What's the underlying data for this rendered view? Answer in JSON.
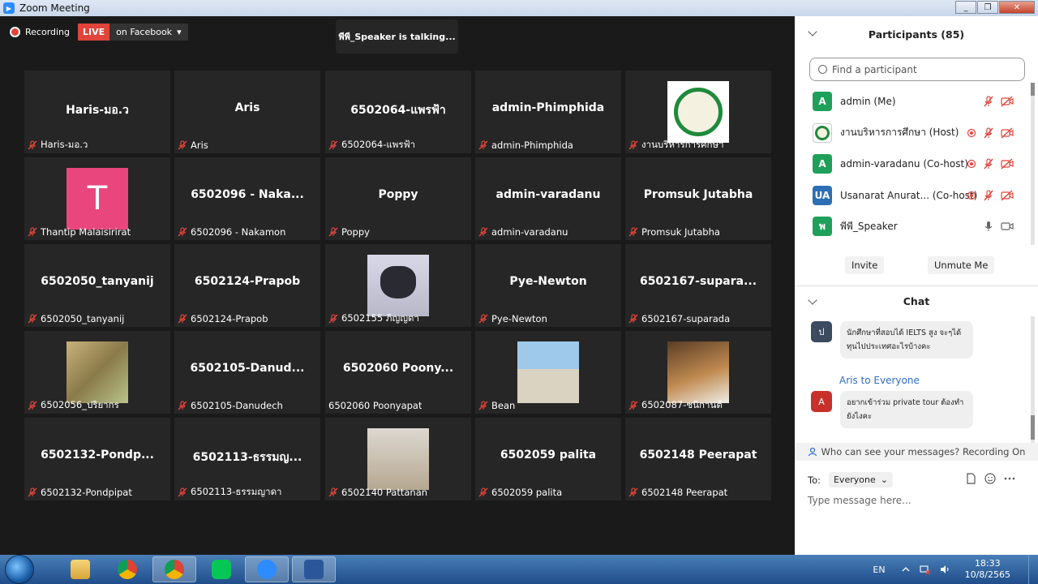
{
  "window": {
    "title": "Zoom Meeting",
    "win_min": "_",
    "win_max": "❐",
    "win_close": "✕"
  },
  "recording": {
    "label": "Recording",
    "live": "LIVE",
    "destination": "on Facebook",
    "caret": "▾"
  },
  "talking": "พีพี_Speaker  is  talking...",
  "tiles": [
    {
      "center": "Haris-มอ.ว",
      "label": "Haris-มอ.ว",
      "pic": ""
    },
    {
      "center": "Aris",
      "label": "Aris",
      "pic": ""
    },
    {
      "center": "6502064-แพรฟ้า",
      "label": "6502064-แพรฟ้า",
      "pic": ""
    },
    {
      "center": "admin-Phimphida",
      "label": "admin-Phimphida",
      "pic": ""
    },
    {
      "center": "",
      "label": "งานบริหารการศึกษา",
      "pic": "seal"
    },
    {
      "center": "",
      "label": "Thantip Malaisirirat",
      "pic": "avatar-t",
      "avatar_letter": "T"
    },
    {
      "center": "6502096 - Naka...",
      "label": "6502096 - Nakamon",
      "pic": ""
    },
    {
      "center": "Poppy",
      "label": "Poppy",
      "pic": ""
    },
    {
      "center": "admin-varadanu",
      "label": "admin-varadanu",
      "pic": ""
    },
    {
      "center": "Promsuk Jutabha",
      "label": "Promsuk Jutabha",
      "pic": ""
    },
    {
      "center": "6502050_tanyanij",
      "label": "6502050_tanyanij",
      "pic": ""
    },
    {
      "center": "6502124-Prapob",
      "label": "6502124-Prapob",
      "pic": ""
    },
    {
      "center": "",
      "label": "6502155 ภิญญดา",
      "pic": "cat"
    },
    {
      "center": "Pye-Newton",
      "label": "Pye-Newton",
      "pic": ""
    },
    {
      "center": "6502167-supara...",
      "label": "6502167-suparada",
      "pic": ""
    },
    {
      "center": "",
      "label": "6502056_ปริยากร",
      "pic": "outdoor"
    },
    {
      "center": "6502105-Danud...",
      "label": "6502105-Danudech",
      "pic": ""
    },
    {
      "center": "6502060  Poony...",
      "label": "6502060  Poonyapat",
      "pic": "",
      "no_mute": true
    },
    {
      "center": "",
      "label": "Bean",
      "pic": "beach"
    },
    {
      "center": "",
      "label": "6502087-ชนิกานต์",
      "pic": "dog"
    },
    {
      "center": "6502132-Pondp...",
      "label": "6502132-Pondpipat",
      "pic": ""
    },
    {
      "center": "6502113-ธรรมญ...",
      "label": "6502113-ธรรมญาดา",
      "pic": ""
    },
    {
      "center": "",
      "label": "6502140 Pattanan",
      "pic": "building"
    },
    {
      "center": "6502059 palita",
      "label": "6502059 palita",
      "pic": ""
    },
    {
      "center": "6502148 Peerapat",
      "label": "6502148 Peerapat",
      "pic": ""
    }
  ],
  "participants": {
    "header": "Participants (85)",
    "search_placeholder": "Find a participant",
    "list": [
      {
        "avatar": "A",
        "color": "#1ea05a",
        "name": "admin (Me)",
        "icons": "muted"
      },
      {
        "avatar": "",
        "color": "#ffffff",
        "name": "งานบริหารการศึกษา (Host)",
        "icons": "rec-muted"
      },
      {
        "avatar": "A",
        "color": "#1ea05a",
        "name": "admin-varadanu (Co-host)",
        "icons": "rec-muted"
      },
      {
        "avatar": "UA",
        "color": "#2c6fb5",
        "name": "Usanarat Anurat...  (Co-host)",
        "icons": "rec-muted"
      },
      {
        "avatar": "พ",
        "color": "#1ea05a",
        "name": "พีพี_Speaker",
        "icons": "live"
      }
    ],
    "invite": "Invite",
    "unmute_me": "Unmute Me"
  },
  "chat": {
    "header": "Chat",
    "messages": [
      {
        "avatar": "ป",
        "color": "#3b4b60",
        "sender": "",
        "text": "นักศึกษาที่สอบได้ IELTS สูง จะๆได้ทุนไปประเทศอะไรบ้างคะ"
      },
      {
        "avatar": "A",
        "color": "#c8312a",
        "sender": "Aris to Everyone",
        "text": "อยากเข้าร่วม private tour ต้องทำยังไงคะ"
      }
    ],
    "who_can_see": "Who can see your messages? Recording On",
    "to_label": "To:",
    "to_value": "Everyone",
    "to_caret": "⌄",
    "placeholder": "Type message here..."
  },
  "taskbar": {
    "lang": "EN",
    "time": "18:33",
    "date": "10/8/2565"
  },
  "colors": {
    "accent": "#2d8cff",
    "mute_red": "#e0443a",
    "live_red": "#e0443a"
  }
}
